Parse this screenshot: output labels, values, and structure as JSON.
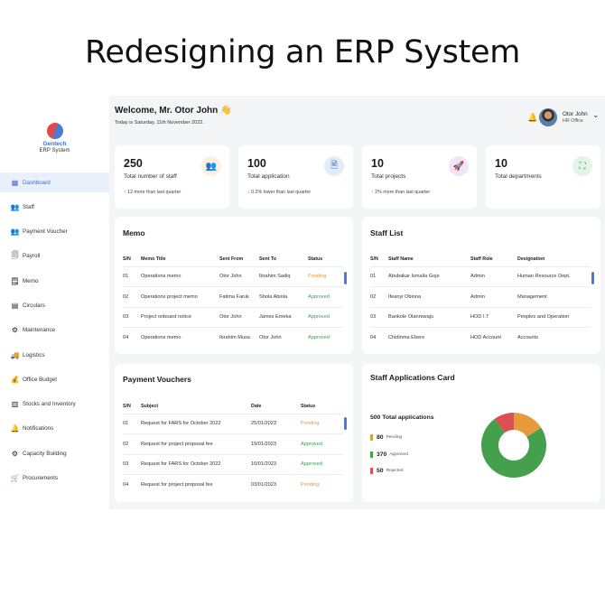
{
  "hero": {
    "title": "Redesigning an ERP System"
  },
  "brand": {
    "name": "Gentech",
    "sub": "ERP System"
  },
  "nav": [
    {
      "label": "Dashboard",
      "icon": "dashboard-icon",
      "active": true
    },
    {
      "label": "Staff",
      "icon": "people-icon"
    },
    {
      "label": "Payment Voucher",
      "icon": "people-icon"
    },
    {
      "label": "Payroll",
      "icon": "payroll-icon"
    },
    {
      "label": "Memo",
      "icon": "memo-icon"
    },
    {
      "label": "Circulars",
      "icon": "circulars-icon"
    },
    {
      "label": "Maintenance",
      "icon": "maintenance-icon"
    },
    {
      "label": "Logistics",
      "icon": "logistics-icon"
    },
    {
      "label": "Office Budget",
      "icon": "budget-icon"
    },
    {
      "label": "Stocks and Inventory",
      "icon": "inventory-icon"
    },
    {
      "label": "Notifications",
      "icon": "bell-icon"
    },
    {
      "label": "Capacity Building",
      "icon": "capacity-icon"
    },
    {
      "label": "Procurements",
      "icon": "procurement-icon"
    }
  ],
  "header": {
    "welcome": "Welcome, Mr. Otor John 👋",
    "date": "Today is Saturday, 11th November 2022.",
    "user_name": "Otor John",
    "user_role": "HR Office"
  },
  "stats": [
    {
      "value": "250",
      "label": "Total number of staff",
      "trend": "12 more than last quarter",
      "trend_dir": "up",
      "icon": "staff-icon",
      "icon_bg": "#fdeedd",
      "icon_color": "#e59a2e"
    },
    {
      "value": "100",
      "label": "Total application",
      "trend": "0.2% lower than last quarter",
      "trend_dir": "down",
      "icon": "document-icon",
      "icon_bg": "#e3ecfb",
      "icon_color": "#3b6fd4"
    },
    {
      "value": "10",
      "label": "Total projects",
      "trend": "2% more than last quarter",
      "trend_dir": "up",
      "icon": "rocket-icon",
      "icon_bg": "#f2e4fb",
      "icon_color": "#a23fd6"
    },
    {
      "value": "10",
      "label": "Total departments",
      "trend": "",
      "trend_dir": "",
      "icon": "org-chart-icon",
      "icon_bg": "#e3f4e6",
      "icon_color": "#2e9d4f"
    }
  ],
  "memo": {
    "title": "Memo",
    "columns": [
      "S/N",
      "Memo Title",
      "Sent From",
      "Sent To",
      "Status"
    ],
    "rows": [
      [
        "01",
        "Operations memo",
        "Otor John",
        "Ibrahim Sadiq",
        "Pending"
      ],
      [
        "02",
        "Operations project memo",
        "Fatima Faruk",
        "Shola Abiola",
        "Approved"
      ],
      [
        "03",
        "Project onboard notice",
        "Otor John",
        "James Emeka",
        "Approved"
      ],
      [
        "04",
        "Operations memo",
        "Ibrahim Musa",
        "Otor John",
        "Approved"
      ]
    ]
  },
  "staff_list": {
    "title": "Staff List",
    "columns": [
      "S/N",
      "Staff Name",
      "Staff Role",
      "Designation"
    ],
    "rows": [
      [
        "01",
        "Abubakar Ismaila Goje",
        "Admin",
        "Human Resource Dept."
      ],
      [
        "02",
        "Ifeanyi Obinna",
        "Admin",
        "Management"
      ],
      [
        "03",
        "Bankole Olanrewaju",
        "HOD I.T",
        "Peoples and Operation"
      ],
      [
        "04",
        "Chidinma Ebere",
        "HOD Account",
        "Accounts"
      ]
    ]
  },
  "vouchers": {
    "title": "Payment Vouchers",
    "columns": [
      "S/N",
      "Subject",
      "Date",
      "Status"
    ],
    "rows": [
      [
        "01",
        "Request for FARS for October 2022",
        "25/01/2023",
        "Pending"
      ],
      [
        "02",
        "Request for project proposal fee",
        "19/01/2023",
        "Approved"
      ],
      [
        "03",
        "Request for FARS for October 2022",
        "10/01/2023",
        "Approved"
      ],
      [
        "04",
        "Request for project proposal fee",
        "03/01/2023",
        "Pending"
      ]
    ]
  },
  "applications": {
    "title": "Staff Applications Card",
    "total_label": "500 Total applications",
    "legend": [
      {
        "count": "80",
        "label": "Pending",
        "color": "#e59a3c"
      },
      {
        "count": "370",
        "label": "Approved",
        "color": "#44a04c"
      },
      {
        "count": "50",
        "label": "Rejected",
        "color": "#dc4f52"
      }
    ]
  },
  "chart_data": {
    "type": "pie",
    "donut": true,
    "categories": [
      "Pending",
      "Approved",
      "Rejected"
    ],
    "values": [
      80,
      370,
      50
    ],
    "colors": [
      "#e59a3c",
      "#44a04c",
      "#dc4f52"
    ],
    "total": 500
  }
}
